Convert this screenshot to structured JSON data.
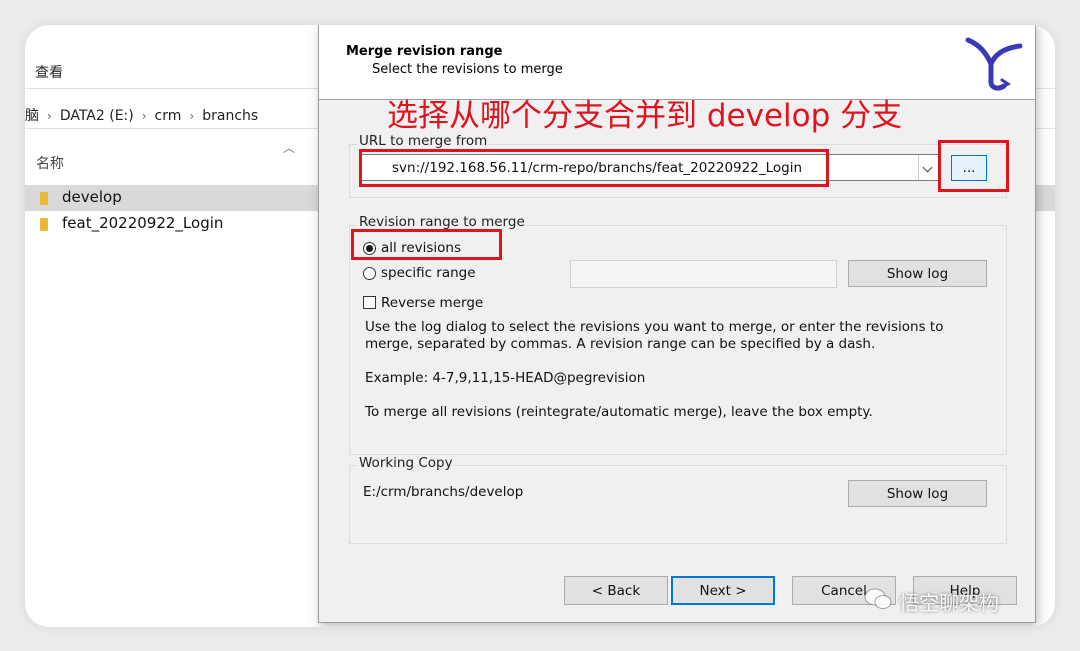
{
  "explorer": {
    "menu_label": "查看",
    "breadcrumb": [
      "脑",
      "DATA2 (E:)",
      "crm",
      "branchs"
    ],
    "column_header": "名称",
    "items": [
      {
        "name": "develop",
        "selected": true
      },
      {
        "name": "feat_20220922_Login",
        "selected": false
      }
    ]
  },
  "dialog": {
    "title": "Merge revision range",
    "subtitle": "Select the revisions to merge",
    "annotation": "选择从哪个分支合并到 develop 分支",
    "url_group": {
      "title": "URL to merge from",
      "value": "svn://192.168.56.11/crm-repo/branchs/feat_20220922_Login",
      "browse_label": "..."
    },
    "revision_group": {
      "title": "Revision range to merge",
      "all_revisions_label": "all revisions",
      "specific_range_label": "specific range",
      "specific_range_value": "",
      "show_log_label": "Show log",
      "reverse_merge_label": "Reverse merge",
      "help_text": "Use the log dialog to select the revisions you want to merge, or enter the revisions to merge, separated by commas. A revision range can be specified by a dash.",
      "example_text": "Example: 4-7,9,11,15-HEAD@pegrevision",
      "empty_hint": "To merge all revisions (reintegrate/automatic merge), leave the box empty.",
      "selected_option": "all revisions",
      "reverse_merge_checked": false
    },
    "working_copy_group": {
      "title": "Working Copy",
      "path": "E:/crm/branchs/develop",
      "show_log_label": "Show log"
    },
    "footer": {
      "back_label": "< Back",
      "next_label": "Next >",
      "cancel_label": "Cancel",
      "help_label": "Help"
    }
  },
  "watermark": "悟空聊架构",
  "colors": {
    "annotation_red": "#e0141e",
    "focus_blue": "#0078d7",
    "dialog_bg": "#f0f0f0",
    "logo_blue": "#3a3ab8"
  }
}
